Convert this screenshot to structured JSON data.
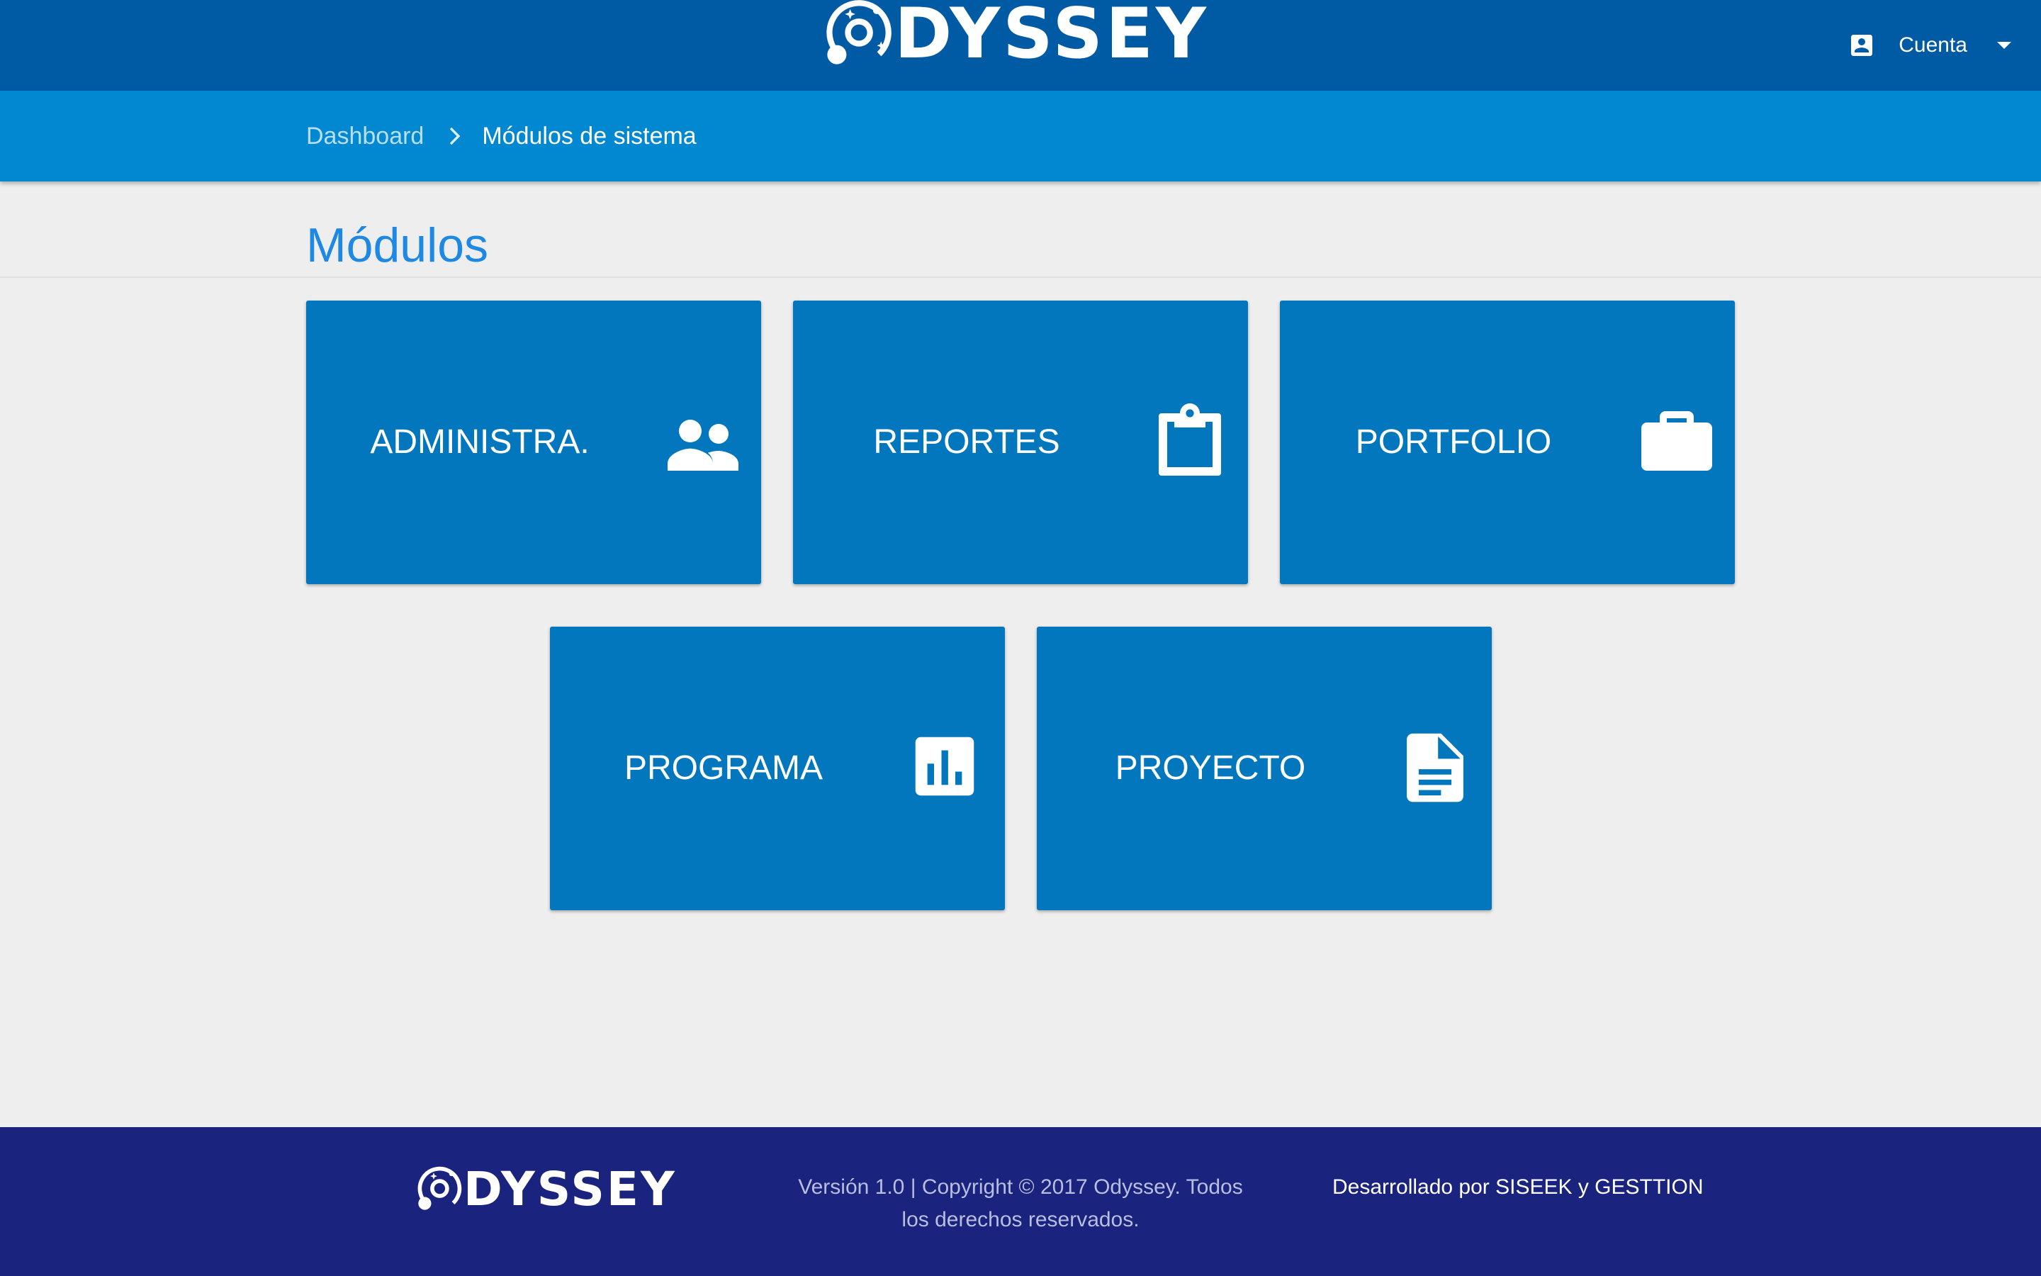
{
  "brand": {
    "name": "DYSSEY",
    "mark_icon": "odyssey-orbit-logo"
  },
  "header": {
    "account_label": "Cuenta",
    "account_icon": "account-box-icon",
    "dropdown_icon": "caret-down-icon"
  },
  "breadcrumb": {
    "items": [
      "Dashboard",
      "Módulos de sistema"
    ],
    "separator_icon": "chevron-right-icon"
  },
  "section": {
    "title": "Módulos"
  },
  "modules": [
    {
      "label": "ADMINISTRA.",
      "icon": "people-icon"
    },
    {
      "label": "REPORTES",
      "icon": "clipboard-icon"
    },
    {
      "label": "PORTFOLIO",
      "icon": "briefcase-icon"
    },
    {
      "label": "PROGRAMA",
      "icon": "bar-chart-icon"
    },
    {
      "label": "PROYECTO",
      "icon": "document-icon"
    }
  ],
  "footer": {
    "brand": "DYSSEY",
    "copyright_line1": "Versión 1.0 | Copyright © 2017 Odyssey. Todos",
    "copyright_line2": "los derechos reservados.",
    "developer": "Desarrollado por SISEEK y GESTTION"
  },
  "colors": {
    "topbar": "#015ba4",
    "breadcrumb_bar": "#0288d1",
    "tile": "#0277bd",
    "title": "#1e88e5",
    "background": "#eeeeee",
    "footer": "#1a237e"
  }
}
